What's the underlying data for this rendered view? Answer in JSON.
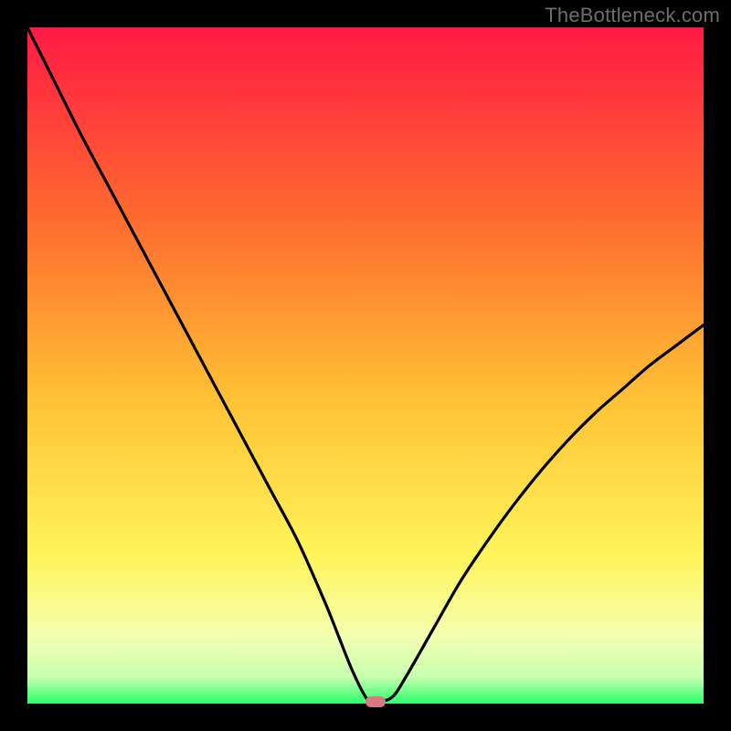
{
  "watermark": "TheBottleneck.com",
  "colors": {
    "background": "#000000",
    "gradient_top": "#ff1a44",
    "gradient_mid1": "#ff8a2a",
    "gradient_mid2": "#ffd92a",
    "gradient_mid3": "#f6ff7a",
    "gradient_bottom": "#2aff6a",
    "curve": "#000000",
    "marker": "#d77a81"
  },
  "chart_data": {
    "type": "line",
    "title": "",
    "xlabel": "",
    "ylabel": "",
    "xlim": [
      0,
      100
    ],
    "ylim": [
      0,
      100
    ],
    "grid": false,
    "legend": false,
    "series": [
      {
        "name": "bottleneck-curve",
        "x": [
          0,
          4,
          8,
          12,
          16,
          20,
          24,
          28,
          32,
          36,
          40,
          44,
          46,
          48,
          50,
          51,
          52,
          54,
          56,
          60,
          64,
          68,
          72,
          76,
          80,
          84,
          88,
          92,
          96,
          100
        ],
        "y": [
          100,
          92,
          84,
          76.5,
          69,
          61.5,
          54,
          46.5,
          39,
          31.5,
          24,
          15,
          10,
          5,
          1,
          0.3,
          0.3,
          1,
          4,
          11,
          18,
          24,
          29.5,
          34.5,
          39,
          43,
          46.5,
          50,
          53,
          56
        ]
      }
    ],
    "annotations": [
      {
        "name": "optimal-marker",
        "x": 51.5,
        "y": 0,
        "shape": "pill",
        "color": "#d77a81"
      }
    ]
  }
}
